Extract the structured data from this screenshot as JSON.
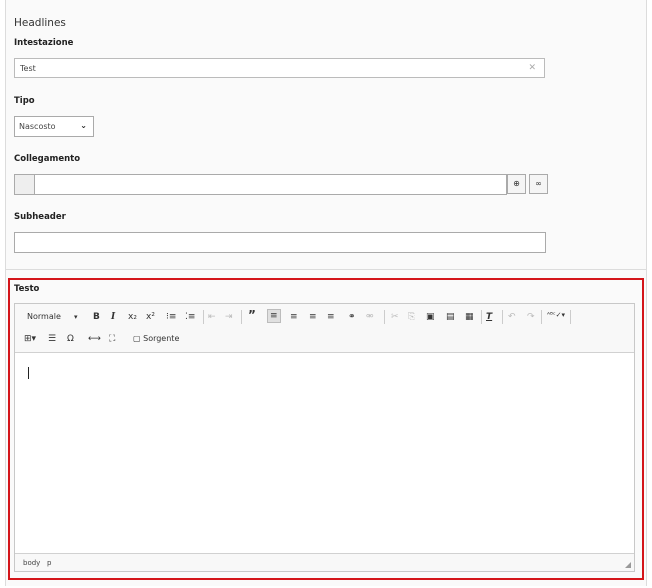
{
  "form": {
    "section_title": "Headlines",
    "header_label": "Intestazione",
    "header_value": "Test",
    "type_label": "Tipo",
    "type_value": "Nascosto",
    "link_label": "Collegamento",
    "subheader_label": "Subheader",
    "text_label": "Testo"
  },
  "editor": {
    "format_value": "Normale",
    "source_label": "Sorgente",
    "path": [
      "body",
      "p"
    ],
    "content": ""
  },
  "colors": {
    "highlight": "#d4151a"
  },
  "icons": {
    "clear": "close-icon",
    "chevron": "chevron-down-icon",
    "link_browser": "link-browser-icon",
    "link": "link-icon"
  }
}
